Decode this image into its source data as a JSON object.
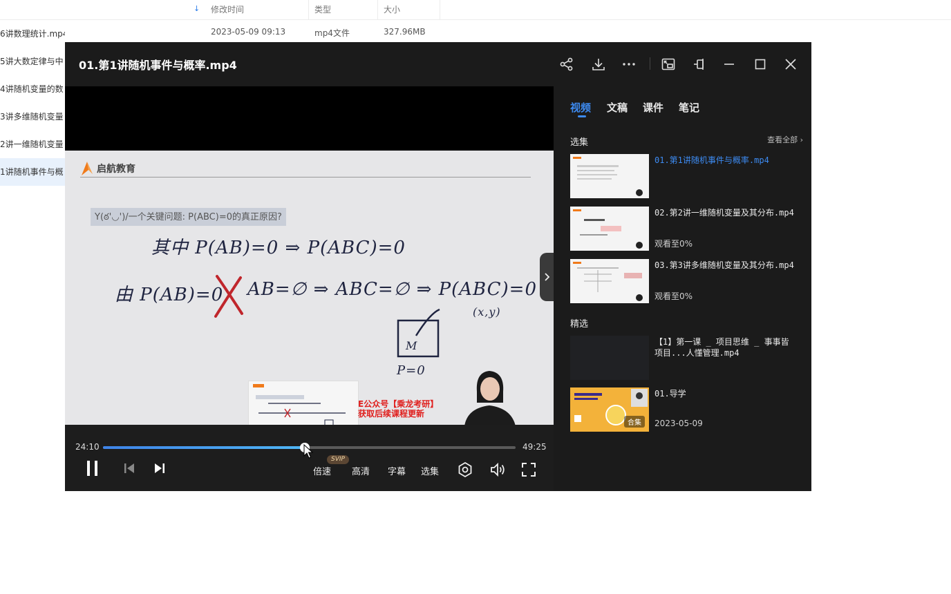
{
  "file_manager": {
    "columns": {
      "modified": "修改时间",
      "type": "类型",
      "size": "大小"
    },
    "rows": [
      {
        "name": "6讲数理统计.mp4"
      },
      {
        "name": "5讲大数定律与中"
      },
      {
        "name": "4讲随机变量的数"
      },
      {
        "name": "3讲多维随机变量"
      },
      {
        "name": "2讲一维随机变量"
      },
      {
        "name": "1讲随机事件与概"
      }
    ],
    "first_row_meta": {
      "modified": "2023-05-09 09:13",
      "type": "mp4文件",
      "size": "327.96MB"
    }
  },
  "player": {
    "title": "01.第1讲随机事件与概率.mp4",
    "slide": {
      "logo_text": "启航教育",
      "question": "Y(ఠ'◡')/一个关键问题: P(ABC)=0的真正原因?",
      "line1": "其中 P(AB)=0  ⇒ P(ABC)=0",
      "line2_a": "由 P(AB)=0",
      "line2_b": "AB=∅ ⇒ ABC=∅ ⇒ P(ABC)=0",
      "point_label": "(x,y)",
      "box_label": "M",
      "p_label": "P=0",
      "promo_line1": "E公众号【乘龙考研】",
      "promo_line2": "获取后续课程更新"
    },
    "controls": {
      "current_time": "24:10",
      "total_time": "49:25",
      "progress": 0.489,
      "speed_label": "倍速",
      "speed_badge": "SVIP",
      "quality_label": "高清",
      "subtitle_label": "字幕",
      "episodes_label": "选集"
    },
    "panel": {
      "tabs": [
        "视频",
        "文稿",
        "课件",
        "笔记"
      ],
      "active_tab": "视频",
      "episodes_title": "选集",
      "view_all": "查看全部",
      "episodes": [
        {
          "title": "01.第1讲随机事件与概率.mp4",
          "sub": ""
        },
        {
          "title": "02.第2讲一维随机变量及其分布.mp4",
          "sub": "观看至0%"
        },
        {
          "title": "03.第3讲多维随机变量及其分布.mp4",
          "sub": "观看至0%"
        }
      ],
      "featured_title": "精选",
      "featured": [
        {
          "title": "【1】第一课 _ 项目思维 _ 事事皆项目...人懂管理.mp4",
          "sub": ""
        },
        {
          "title": "01.导学",
          "sub": "2023-05-09",
          "thumb_badge": "合集"
        }
      ]
    },
    "colors": {
      "accent": "#3d8bf2",
      "background": "#181818",
      "promo": "#e0201e"
    }
  }
}
